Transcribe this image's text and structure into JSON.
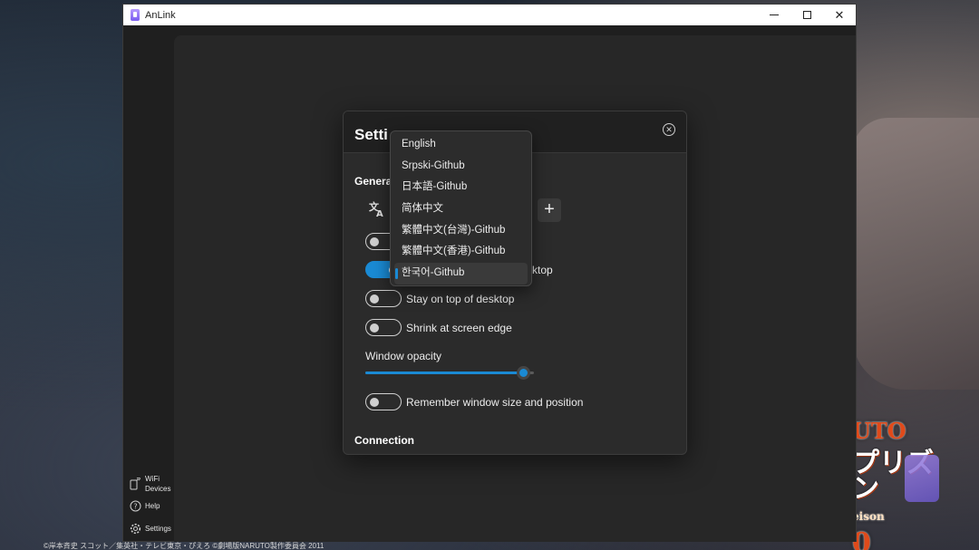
{
  "window": {
    "title": "AnLink",
    "minimize_glyph": "",
    "maximize_glyph": "",
    "close_glyph": "✕"
  },
  "sidebar": {
    "items": [
      {
        "label": "WiFi\nDevices",
        "label_line1": "WiFi",
        "label_line2": "Devices",
        "icon": "wifi-devices-icon"
      },
      {
        "label": "Help",
        "icon": "help-icon"
      },
      {
        "label": "Settings",
        "icon": "gear-icon"
      }
    ]
  },
  "settings": {
    "title": "Setti",
    "close_icon": "close-circle-icon",
    "sections": {
      "general": "Genera",
      "connection": "Connection"
    },
    "language": {
      "icon": "translate-icon",
      "add_label": "+"
    },
    "options": {
      "toggle1": {
        "label": "",
        "on": false
      },
      "toggle2": {
        "label_partial": "ktop",
        "on": true
      },
      "stay_on_top": {
        "label": "Stay on top of desktop",
        "on": false
      },
      "shrink_edge": {
        "label": "Shrink at screen edge",
        "on": false
      },
      "remember_window": {
        "label": "Remember window size and position",
        "on": false
      }
    },
    "opacity": {
      "label": "Window opacity",
      "value": 0.94
    }
  },
  "language_dropdown": {
    "selected_index": 6,
    "options": [
      "English",
      "Srpski-Github",
      "日本語-Github",
      "简体中文",
      "繁體中文(台灣)-Github",
      "繁體中文(香港)-Github",
      "한국어-Github"
    ]
  },
  "wallpaper": {
    "logo_line1": "UTO",
    "logo_line2": "プリズン",
    "logo_line3": "eison",
    "logo_line4": "0",
    "credit": "©岸本斉史 スコット／集英社・テレビ東京・ぴえろ ©劇場版NARUTO製作委員会 2011"
  },
  "colors": {
    "accent": "#1a8ad4",
    "window_bg": "#1f1f1f",
    "panel_bg": "#272727",
    "dialog_bg": "#2b2b2b"
  }
}
